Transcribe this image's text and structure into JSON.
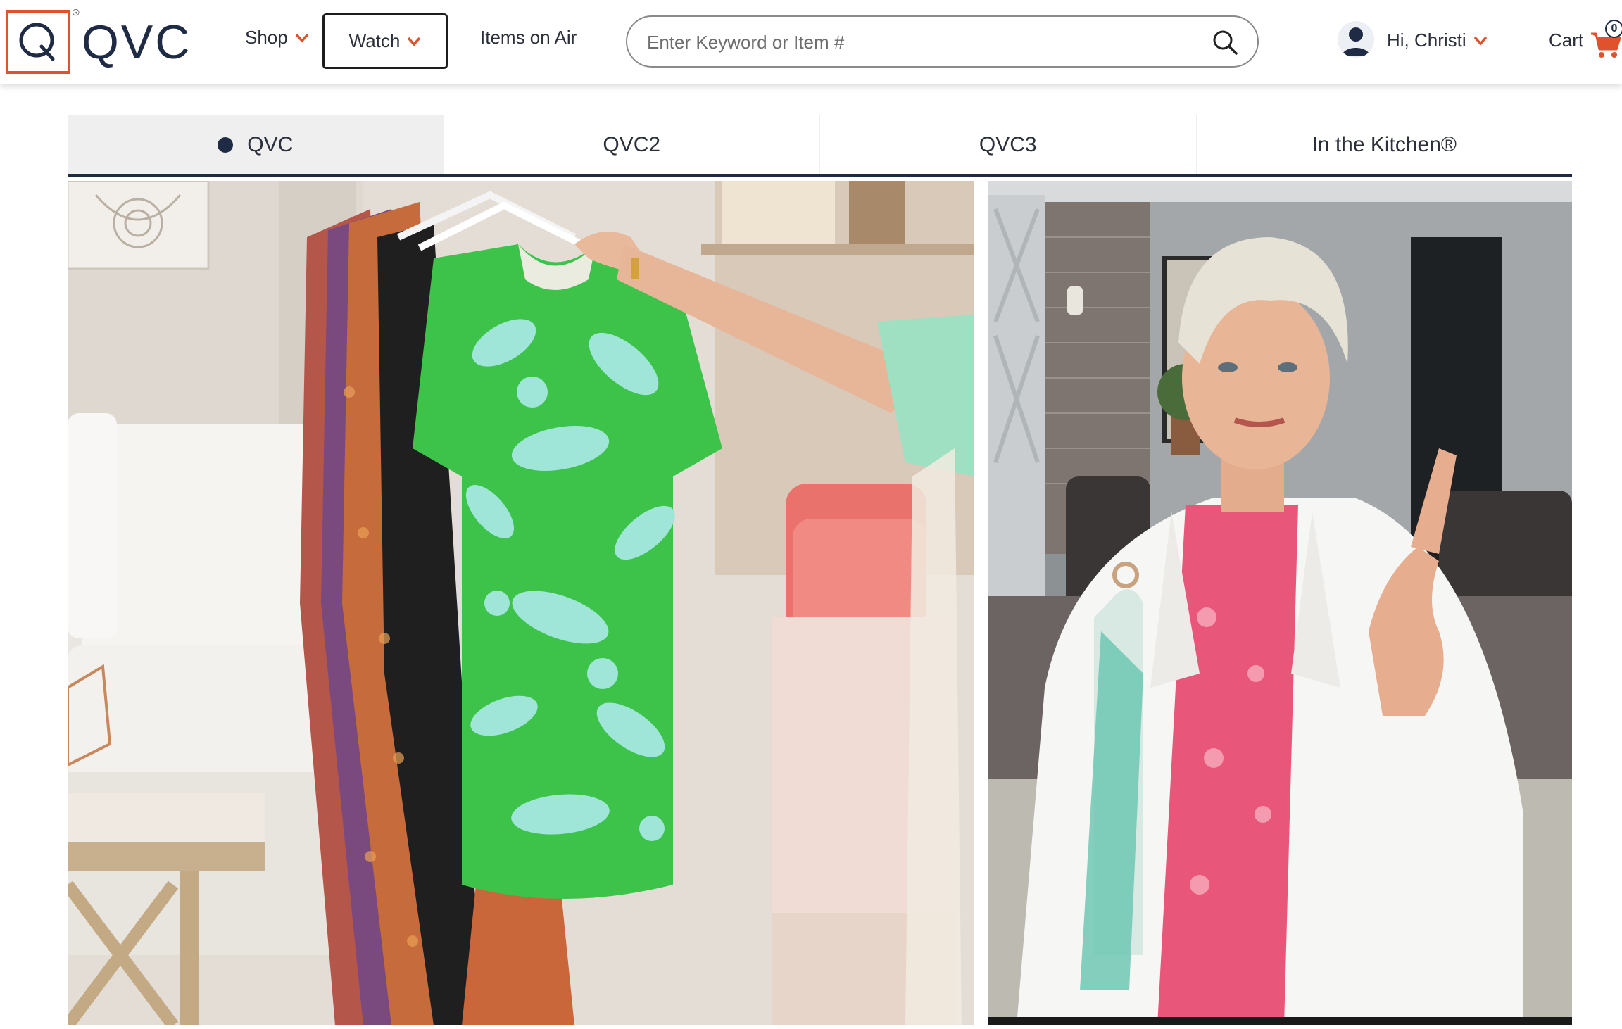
{
  "header": {
    "logo": {
      "letter": "Q",
      "wordmark": "QVC",
      "registered": "®",
      "brand_color": "#e0522c",
      "navy": "#1f2a44"
    },
    "nav": {
      "shop_label": "Shop",
      "watch_label": "Watch",
      "items_on_air_label": "Items on Air"
    },
    "search": {
      "placeholder": "Enter Keyword or Item #",
      "value": "",
      "icon": "search-icon"
    },
    "account": {
      "greeting": "Hi, Christi",
      "icon": "user-icon"
    },
    "cart": {
      "label": "Cart",
      "count": "0",
      "icon": "cart-icon",
      "icon_color": "#e0522c"
    },
    "chevron_color": "#e0522c"
  },
  "channels": {
    "tabs": [
      {
        "label": "QVC",
        "active": true,
        "live_indicator": true
      },
      {
        "label": "QVC2",
        "active": false
      },
      {
        "label": "QVC3",
        "active": false
      },
      {
        "label": "In the Kitchen®",
        "active": false
      }
    ]
  },
  "videos": {
    "main_stream": {
      "subject": "green floral t-shirt on hanger in living room set"
    },
    "side_stream": {
      "subject": "host in white jacket pointing at camera"
    }
  }
}
